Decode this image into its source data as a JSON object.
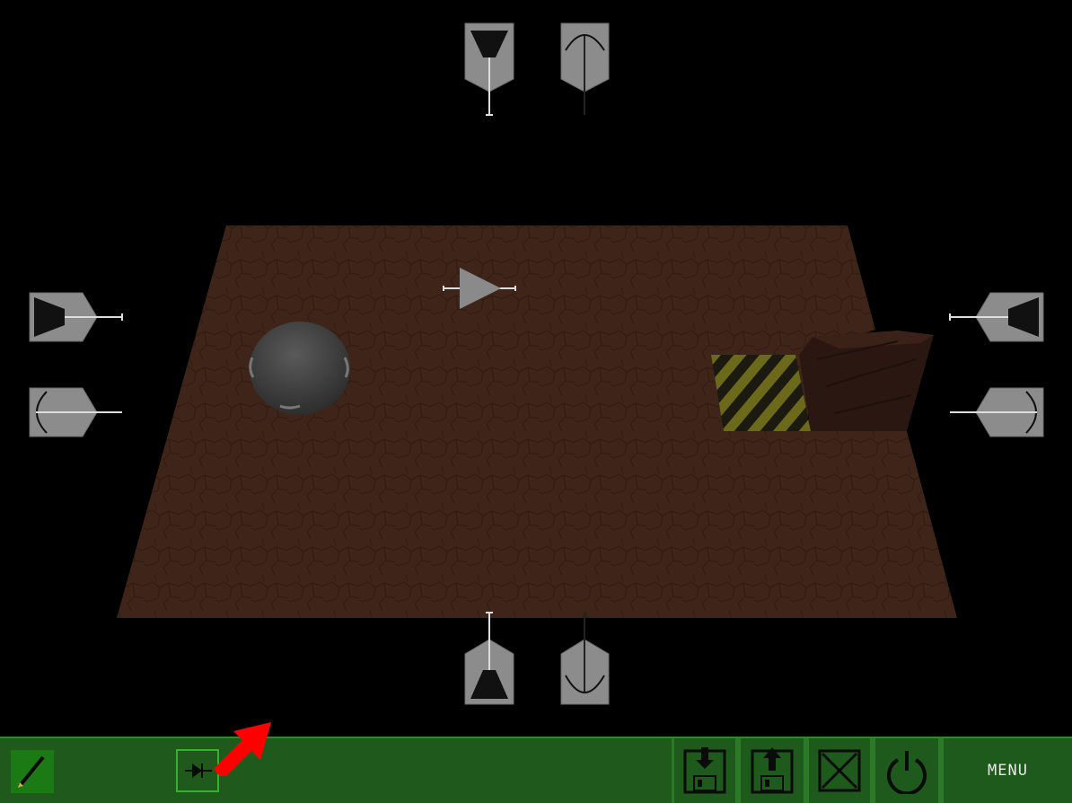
{
  "game": {
    "board": {
      "floor_color": "#3f2519",
      "hazard_colors": [
        "#6b6a1a",
        "#1c1a10"
      ]
    },
    "pieces": {
      "top_left": {
        "icon": "trapezoid-emitter-icon",
        "color": "#8c8c8c"
      },
      "top_right": {
        "icon": "arc-emitter-icon",
        "color": "#8c8c8c"
      },
      "left_top": {
        "icon": "trapezoid-emitter-icon",
        "color": "#8c8c8c"
      },
      "left_bottom": {
        "icon": "arc-emitter-icon",
        "color": "#8c8c8c"
      },
      "right_top": {
        "icon": "trapezoid-emitter-icon",
        "color": "#8c8c8c"
      },
      "right_bottom": {
        "icon": "arc-emitter-icon",
        "color": "#8c8c8c"
      },
      "bottom_left": {
        "icon": "trapezoid-emitter-icon",
        "color": "#8c8c8c"
      },
      "bottom_right": {
        "icon": "arc-emitter-icon",
        "color": "#8c8c8c"
      },
      "center": {
        "icon": "triangle-diode-icon",
        "color": "#8a8a8a"
      },
      "sphere": {
        "icon": "sphere-ball-icon",
        "color": "#404040"
      }
    }
  },
  "toolbar": {
    "background": "#1f5a1c",
    "accent": "#2f8a2a",
    "edit_tool": {
      "icon": "pencil-icon"
    },
    "selected_tool": {
      "icon": "diode-icon"
    },
    "pointer": {
      "icon": "red-arrow-icon",
      "color": "#ff0000"
    },
    "save": {
      "icon": "save-floppy-icon"
    },
    "load": {
      "icon": "load-floppy-icon"
    },
    "clear": {
      "icon": "close-x-icon"
    },
    "power": {
      "icon": "power-icon"
    },
    "menu": {
      "label": "MENU"
    }
  }
}
